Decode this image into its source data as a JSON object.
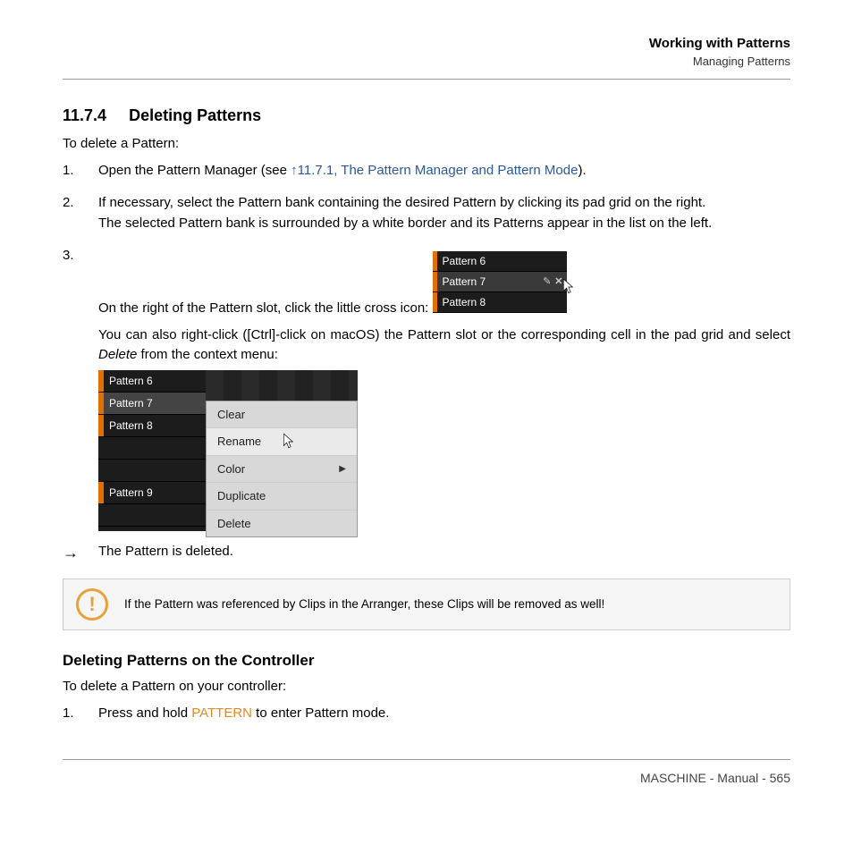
{
  "header": {
    "title": "Working with Patterns",
    "subtitle": "Managing Patterns"
  },
  "section": {
    "number": "11.7.4",
    "title": "Deleting Patterns",
    "intro": "To delete a Pattern:",
    "step1_a": "Open the Pattern Manager (see ",
    "step1_link": "↑11.7.1, The Pattern Manager and Pattern Mode",
    "step1_b": ").",
    "step2_a": "If necessary, select the Pattern bank containing the desired Pattern by clicking its pad grid on the right.",
    "step2_b": "The selected Pattern bank is surrounded by a white border and its Patterns appear in the list on the left.",
    "step3": "On the right of the Pattern slot, click the little cross icon:",
    "step3_after_a": "You can also right-click ([Ctrl]-click on macOS) the Pattern slot or the corresponding cell in the pad grid and select ",
    "step3_after_italic": "Delete",
    "step3_after_b": " from the context menu:",
    "result_arrow": "→",
    "result_text": "The Pattern is deleted.",
    "note": "If the Pattern was referenced by Clips in the Arranger, these Clips will be removed as well!"
  },
  "panel1": {
    "p6": "Pattern 6",
    "p7": "Pattern 7",
    "p8": "Pattern 8"
  },
  "panel2": {
    "p6": "Pattern 6",
    "p7": "Pattern 7",
    "p8": "Pattern 8",
    "p9": "Pattern 9"
  },
  "menu": {
    "clear": "Clear",
    "rename": "Rename",
    "color": "Color",
    "duplicate": "Duplicate",
    "delete": "Delete"
  },
  "sub": {
    "title": "Deleting Patterns on the Controller",
    "intro": "To delete a Pattern on your controller:",
    "step1_a": "Press and hold ",
    "step1_key": "PATTERN",
    "step1_b": " to enter Pattern mode."
  },
  "footer": {
    "text": "MASCHINE - Manual - 565"
  }
}
